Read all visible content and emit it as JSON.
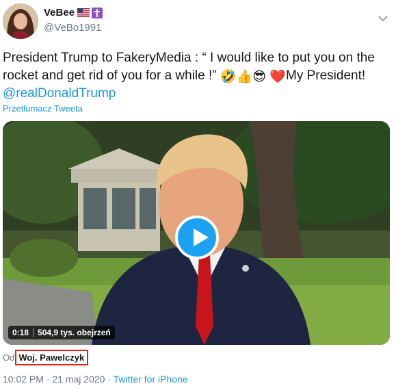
{
  "user": {
    "display_name": "VeBee",
    "handle": "@VeBo1991",
    "badges": [
      "us-flag-icon",
      "cross-badge-icon"
    ]
  },
  "tweet": {
    "text": "President Trump to FakeryMedia : “ I would like to put you on the rocket and get rid of you for a while !” ",
    "emojis": [
      "🤣",
      "👍",
      "😎",
      "❤️"
    ],
    "after_emojis": "My President!",
    "mention": "@realDonaldTrump",
    "translate_label": "Przetłumacz Tweeta"
  },
  "video": {
    "duration": "0:18",
    "views": "504,9 tys. obejrzeń"
  },
  "source": {
    "prefix": "Od",
    "author": "Woj. Pawelczyk"
  },
  "footer": {
    "time": "10:02 PM",
    "dot": " · ",
    "date": "21 maj 2020",
    "client": "Twitter for iPhone"
  },
  "colors": {
    "link": "#1b95e0",
    "play": "#1da1f2",
    "highlight_border": "#e2231a"
  }
}
